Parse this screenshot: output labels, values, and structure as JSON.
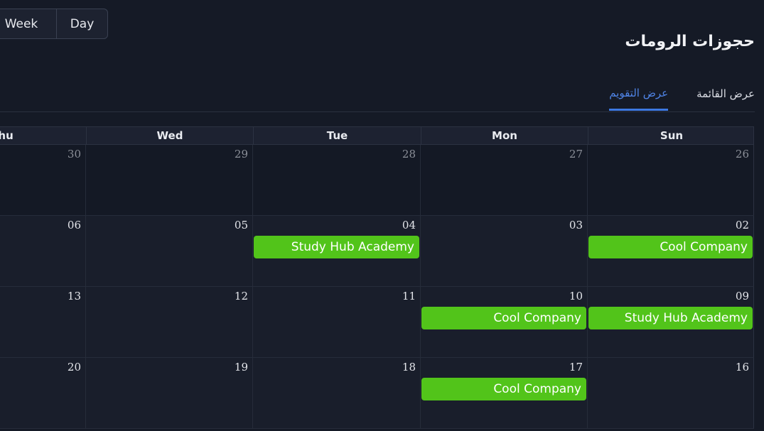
{
  "view_switch": {
    "week_label": "Week",
    "day_label": "Day"
  },
  "page_title": "حجوزات الرومات",
  "tabs": [
    {
      "label": "عرض القائمة",
      "active": false
    },
    {
      "label": "عرض التقويم",
      "active": true
    }
  ],
  "calendar": {
    "columns": [
      "Thu",
      "Wed",
      "Tue",
      "Mon",
      "Sun"
    ],
    "weeks": [
      {
        "days": [
          "30",
          "29",
          "28",
          "27",
          "26"
        ],
        "events": [
          null,
          null,
          null,
          null,
          null
        ]
      },
      {
        "days": [
          "06",
          "05",
          "04",
          "03",
          "02"
        ],
        "events": [
          null,
          null,
          "Study Hub Academy",
          null,
          "Cool Company"
        ]
      },
      {
        "days": [
          "13",
          "12",
          "11",
          "10",
          "09"
        ],
        "events": [
          null,
          null,
          null,
          "Cool Company",
          "Study Hub Academy"
        ]
      },
      {
        "days": [
          "20",
          "19",
          "18",
          "17",
          "16"
        ],
        "events": [
          null,
          null,
          null,
          "Cool Company",
          null
        ]
      }
    ]
  },
  "colors": {
    "background": "#151a26",
    "event": "#52c41a",
    "active_tab": "#3d78e2"
  }
}
